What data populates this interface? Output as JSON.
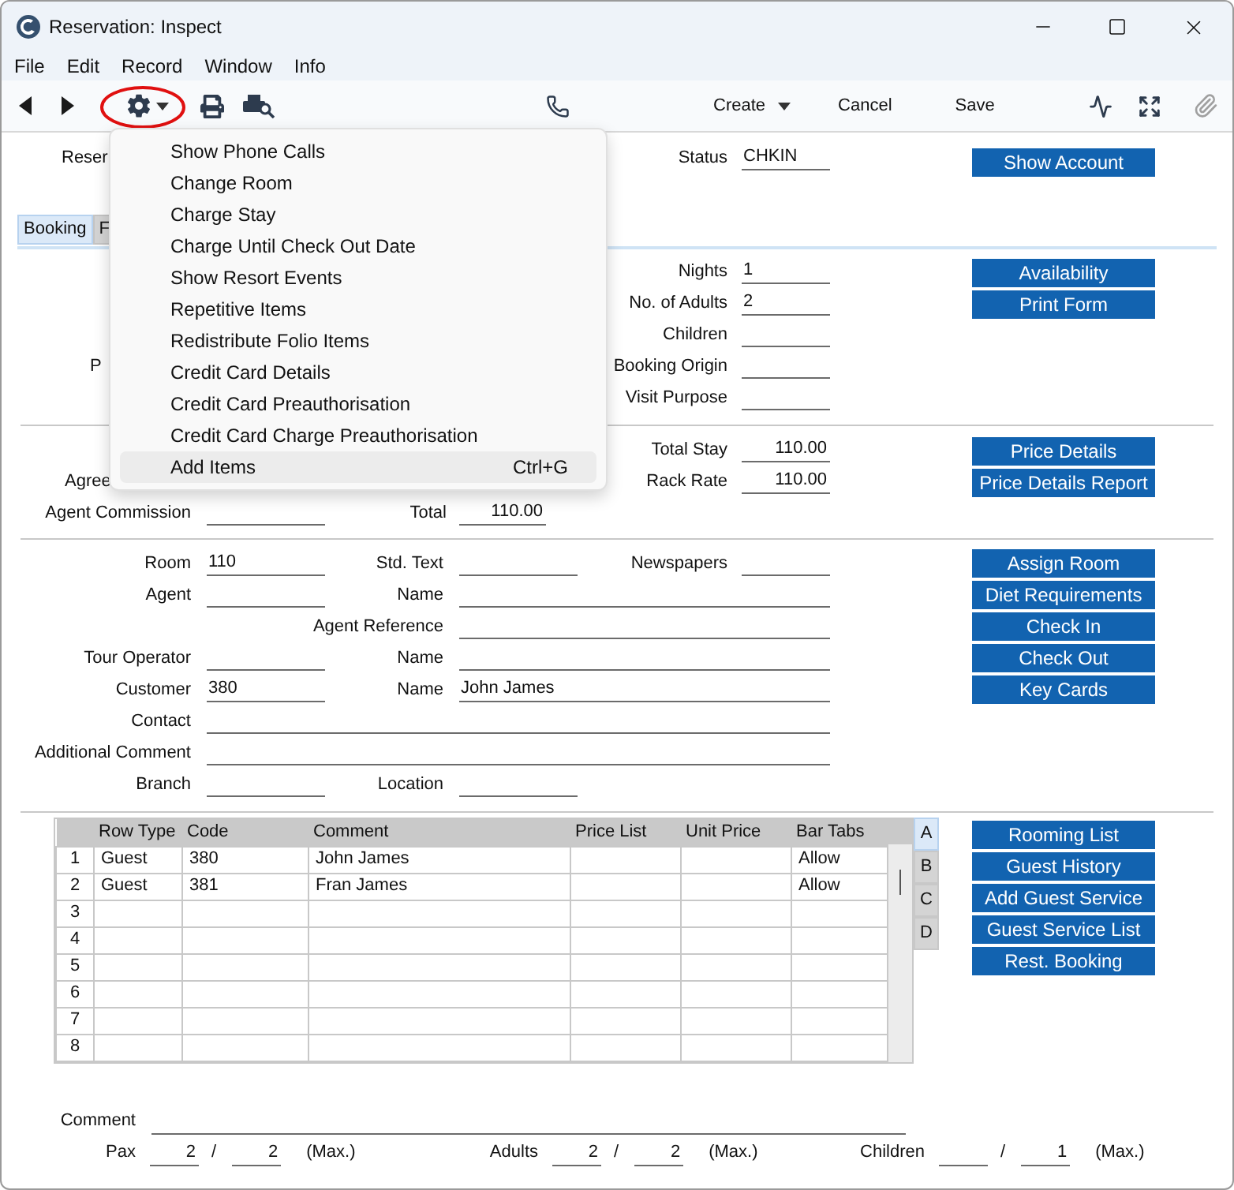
{
  "window": {
    "title": "Reservation: Inspect"
  },
  "menu_bar": [
    "File",
    "Edit",
    "Record",
    "Window",
    "Info"
  ],
  "toolbar": {
    "create": "Create",
    "cancel": "Cancel",
    "save": "Save"
  },
  "header": {
    "reservation_label": "Reser",
    "status_label": "Status",
    "status_value": "CHKIN",
    "button": "Show Account"
  },
  "tabs": [
    {
      "label": "Booking",
      "selected": true
    },
    {
      "label": "F",
      "selected": false
    }
  ],
  "booking": {
    "rows": [
      {
        "label": "Nights",
        "value": "1"
      },
      {
        "label": "No. of Adults",
        "value": "2"
      },
      {
        "label": "Children"
      },
      {
        "left_label": "P",
        "label": "Booking Origin"
      },
      {
        "label": "Visit Purpose"
      }
    ],
    "buttons": [
      "Availability",
      "Print Form"
    ]
  },
  "pricing": {
    "rows": [
      {
        "label": "Total Stay",
        "value": "110.00"
      },
      {
        "left_label": "Agree",
        "label": "Rack Rate",
        "value": "110.00"
      },
      {
        "left_label": "Agent Commission",
        "mid_label": "Total",
        "mid_value": "110.00"
      }
    ],
    "buttons": [
      "Price Details",
      "Price Details Report"
    ]
  },
  "details": {
    "rows": [
      [
        {
          "label": "Room",
          "value": "110",
          "kind": "short"
        },
        {
          "label": "Std. Text",
          "kind": "short"
        },
        {
          "label": "Newspapers",
          "kind": "short"
        }
      ],
      [
        {
          "label": "Agent",
          "kind": "short"
        },
        {
          "label": "Name",
          "kind": "wide"
        }
      ],
      [
        {
          "kind": "empty"
        },
        {
          "label": "Agent Reference",
          "kind": "wide"
        }
      ],
      [
        {
          "label": "Tour Operator",
          "kind": "short"
        },
        {
          "label": "Name",
          "kind": "wide"
        }
      ],
      [
        {
          "label": "Customer",
          "value": "380",
          "kind": "short"
        },
        {
          "label": "Name",
          "value": "John James",
          "kind": "wide"
        }
      ],
      [
        {
          "label": "Contact",
          "kind": "full"
        }
      ],
      [
        {
          "label": "Additional Comment",
          "kind": "full"
        }
      ],
      [
        {
          "label": "Branch",
          "kind": "short"
        },
        {
          "label": "Location",
          "kind": "short"
        }
      ]
    ],
    "buttons": [
      "Assign Room",
      "Diet Requirements",
      "Check In",
      "Check Out",
      "Key Cards"
    ]
  },
  "table": {
    "columns": [
      "Row Type",
      "Code",
      "Comment",
      "Price List",
      "Unit Price",
      "Bar Tabs"
    ],
    "rows": [
      {
        "number": "1",
        "row_type": "Guest",
        "code": "380",
        "comment": "John James",
        "bar_tabs": "Allow"
      },
      {
        "number": "2",
        "row_type": "Guest",
        "code": "381",
        "comment": "Fran James",
        "bar_tabs": "Allow"
      },
      {
        "number": "3"
      },
      {
        "number": "4"
      },
      {
        "number": "5"
      },
      {
        "number": "6"
      },
      {
        "number": "7"
      },
      {
        "number": "8"
      }
    ],
    "side_tabs": [
      {
        "label": "A",
        "selected": true
      },
      {
        "label": "B",
        "selected": false
      },
      {
        "label": "C",
        "selected": false
      },
      {
        "label": "D",
        "selected": false
      }
    ],
    "buttons": [
      "Rooming List",
      "Guest History",
      "Add Guest Service",
      "Guest Service List",
      "Rest. Booking"
    ]
  },
  "footer": {
    "comment_label": "Comment",
    "counts": [
      {
        "label": "Pax",
        "value": "2",
        "separator": "/",
        "max": "2",
        "max_label": "(Max.)"
      },
      {
        "label": "Adults",
        "value": "2",
        "separator": "/",
        "max": "2",
        "max_label": "(Max.)"
      },
      {
        "label": "Children",
        "separator": "/",
        "max": "1",
        "max_label": "(Max.)"
      }
    ]
  },
  "context_menu": {
    "items": [
      {
        "label": "Show Phone Calls",
        "selected": false
      },
      {
        "label": "Change Room",
        "selected": false
      },
      {
        "label": "Charge Stay",
        "selected": false
      },
      {
        "label": "Charge Until Check Out Date",
        "selected": false
      },
      {
        "label": "Show Resort Events",
        "selected": false
      },
      {
        "label": "Repetitive Items",
        "selected": false
      },
      {
        "label": "Redistribute Folio Items",
        "selected": false
      },
      {
        "label": "Credit Card Details",
        "selected": false
      },
      {
        "label": "Credit Card Preauthorisation",
        "selected": false
      },
      {
        "label": "Credit Card Charge Preauthorisation",
        "selected": false
      },
      {
        "label": "Add Items",
        "shortcut": "Ctrl+G",
        "selected": true
      }
    ]
  }
}
